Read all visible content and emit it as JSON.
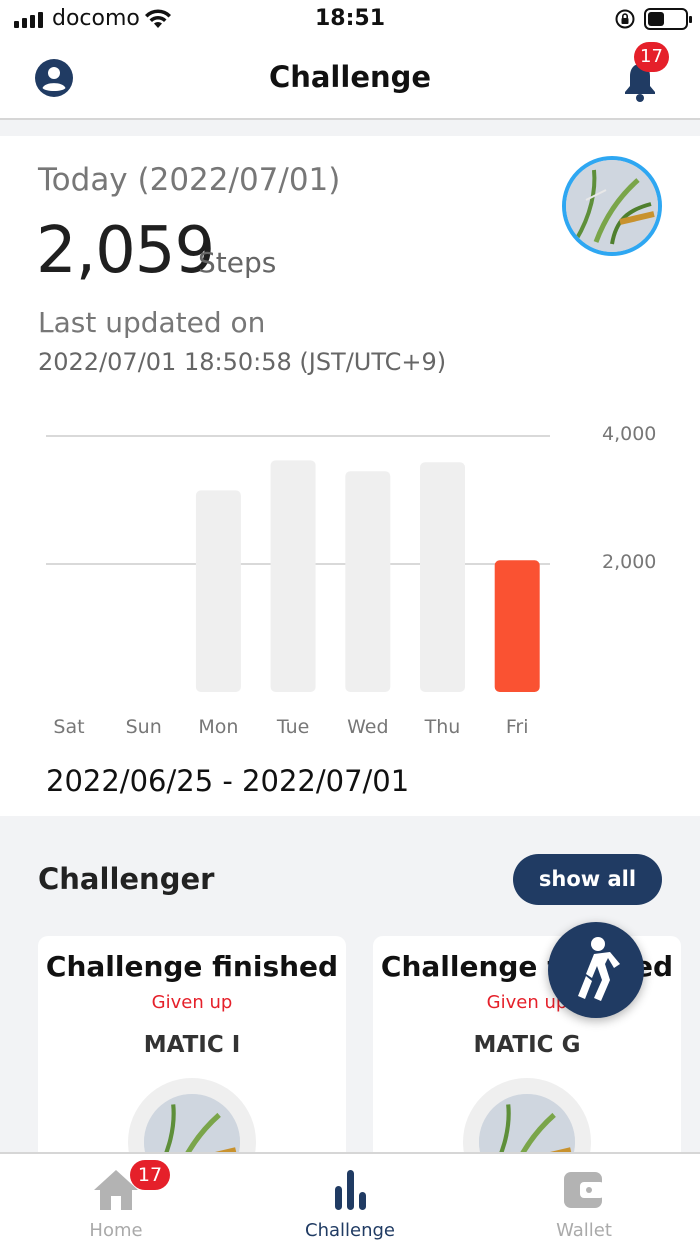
{
  "status_bar": {
    "carrier": "docomo",
    "time": "18:51"
  },
  "header": {
    "title": "Challenge",
    "notification_count": "17",
    "icons": {
      "left": "user-circle-icon",
      "right": "bell-icon"
    }
  },
  "today": {
    "label": "Today (2022/07/01)",
    "steps": "2,059",
    "steps_unit": "Steps",
    "updated_label": "Last updated on",
    "updated_time": "2022/07/01 18:50:58 (JST/UTC+9)"
  },
  "chart_data": {
    "type": "bar",
    "categories": [
      "Sat",
      "Sun",
      "Mon",
      "Tue",
      "Wed",
      "Thu",
      "Fri"
    ],
    "values": [
      0,
      0,
      3150,
      3620,
      3450,
      3590,
      2059
    ],
    "highlight_index": 6,
    "y_ticks": [
      "4,000",
      "2,000"
    ],
    "ylim": [
      0,
      4000
    ],
    "grid": true,
    "colors": {
      "bar": "#efefef",
      "highlight": "#fa5232"
    },
    "date_range": "2022/06/25 - 2022/07/01"
  },
  "challenger": {
    "title": "Challenger",
    "show_all_label": "show all",
    "cards": [
      {
        "title": "Challenge finished",
        "status": "Given up",
        "token": "MATIC I"
      },
      {
        "title": "Challenge finished",
        "status": "Given up",
        "token": "MATIC G"
      }
    ]
  },
  "bottom_nav": {
    "items": [
      {
        "label": "Home",
        "icon": "home-icon",
        "badge": "17"
      },
      {
        "label": "Challenge",
        "icon": "bar-chart-icon"
      },
      {
        "label": "Wallet",
        "icon": "wallet-icon"
      }
    ],
    "active": "Challenge"
  },
  "colors": {
    "primary": "#203b63",
    "accent": "#fa5232",
    "badge": "#e5202a",
    "avatar_ring": "#2ea7f2"
  }
}
